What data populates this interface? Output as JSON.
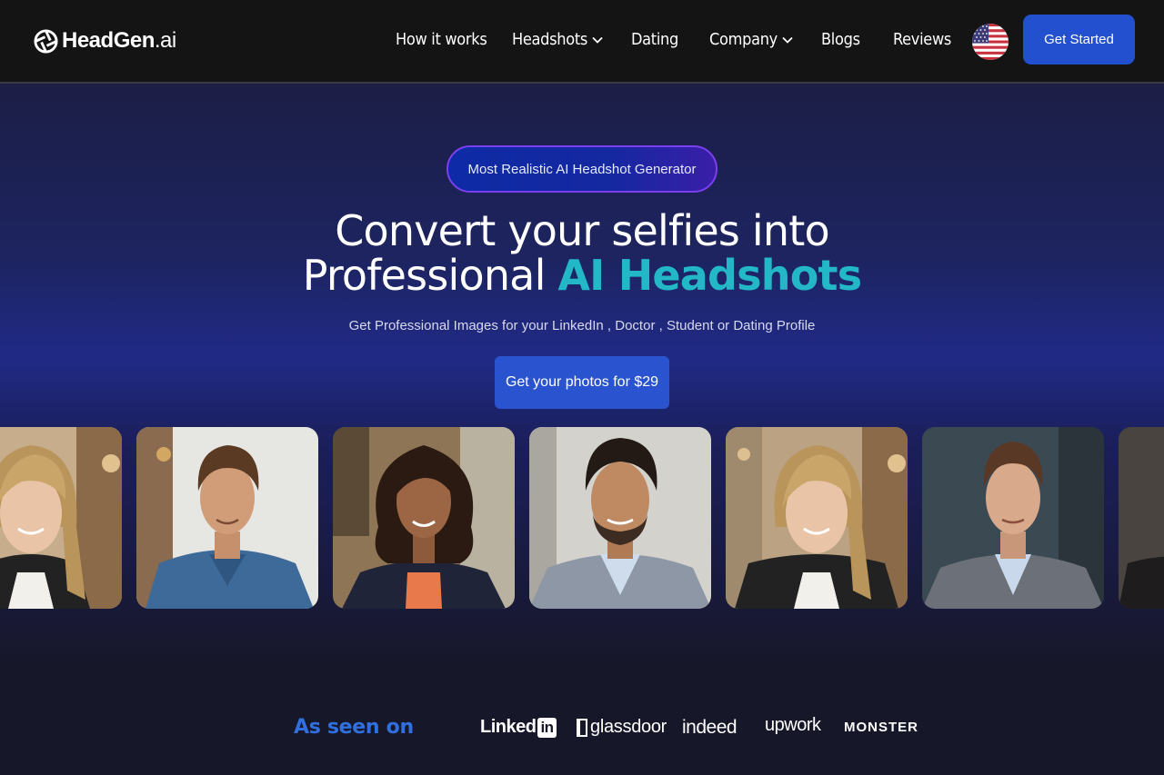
{
  "header": {
    "logo": {
      "brand": "HeadGen",
      "suffix": ".ai",
      "icon": "aperture-icon"
    },
    "nav": [
      {
        "label": "How it works",
        "dropdown": false
      },
      {
        "label": "Headshots",
        "dropdown": true
      },
      {
        "label": "Dating",
        "dropdown": false
      },
      {
        "label": "Company",
        "dropdown": true
      },
      {
        "label": "Blogs",
        "dropdown": false
      },
      {
        "label": "Reviews",
        "dropdown": false
      }
    ],
    "language_icon": "us-flag-icon",
    "cta_label": "Get Started"
  },
  "hero": {
    "badge": "Most Realistic AI Headshot Generator",
    "title_line1": "Convert your selfies into",
    "title_line2_plain": "Professional ",
    "title_line2_accent": "AI Headshots",
    "subtitle": "Get Professional Images for your LinkedIn , Doctor , Student or Dating Profile",
    "cta_label": "Get your photos for $29"
  },
  "gallery": {
    "photos": [
      {
        "subject": "woman-blonde-smiling"
      },
      {
        "subject": "man-curly-hair-denim-shirt"
      },
      {
        "subject": "woman-dark-curly-hair-blazer"
      },
      {
        "subject": "man-beard-gray-blazer"
      },
      {
        "subject": "woman-blonde-smiling"
      },
      {
        "subject": "man-short-hair-gray-blazer"
      },
      {
        "subject": "partial-portrait"
      }
    ]
  },
  "as_seen_on": {
    "label": "As seen on",
    "brands": [
      "Linked",
      "in",
      "glassdoor",
      "indeed",
      "upwork",
      "MONSTER"
    ]
  },
  "colors": {
    "accent_blue": "#2350cf",
    "accent_teal": "#23b8c8",
    "label_blue": "#2f6fe0",
    "nav_bg": "#141414"
  }
}
